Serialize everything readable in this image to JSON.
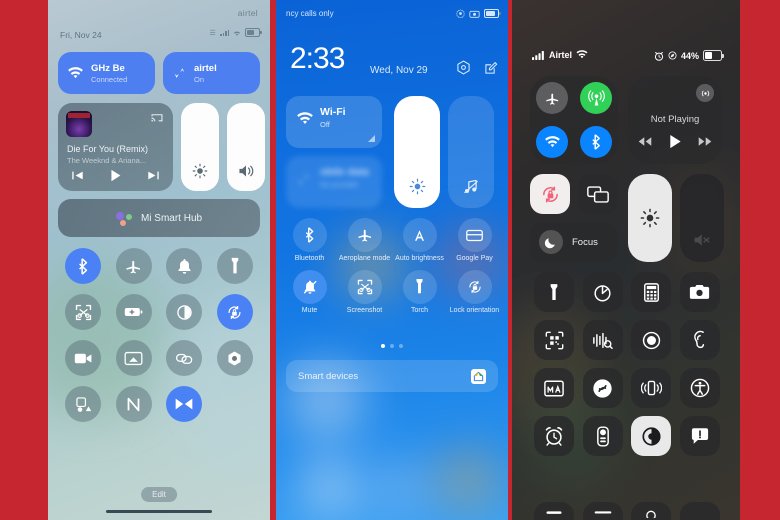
{
  "background_color": "#c62630",
  "panels": {
    "left": {
      "name": "MIUI Control Center (light)",
      "status": {
        "carrier": "airtel",
        "date": "Fri, Nov 24",
        "icons": [
          "vibrate-icon",
          "signal-icon",
          "wifi-icon",
          "battery-icon"
        ]
      },
      "tiles": [
        {
          "name": "wifi-tile",
          "icon": "wifi-icon",
          "title": "GHz   Be",
          "subtitle": "Connected",
          "state": "on"
        },
        {
          "name": "mobile-data-tile",
          "icon": "data-arrows-icon",
          "title": "airtel",
          "subtitle": "On",
          "state": "on"
        }
      ],
      "media": {
        "title": "Die For You (Remix)",
        "artist": "The Weeknd & Ariana...",
        "cast_icon": "cast-icon",
        "controls": [
          "previous-icon",
          "play-icon",
          "next-icon"
        ]
      },
      "sliders": [
        {
          "name": "brightness-slider",
          "icon": "brightness-icon",
          "value": 100
        },
        {
          "name": "volume-slider",
          "icon": "volume-icon",
          "value": 100
        }
      ],
      "smart_hub": {
        "label": "Mi Smart Hub",
        "icon": "assistant-dots-icon"
      },
      "toggles": [
        {
          "name": "bluetooth",
          "icon": "bluetooth-icon",
          "on": true
        },
        {
          "name": "aeroplane-mode",
          "icon": "airplane-icon",
          "on": false
        },
        {
          "name": "ringtone",
          "icon": "bell-icon",
          "on": false
        },
        {
          "name": "torch",
          "icon": "flashlight-icon",
          "on": false
        },
        {
          "name": "screenshot",
          "icon": "screenshot-icon",
          "on": false
        },
        {
          "name": "battery-saver",
          "icon": "battery-plus-icon",
          "on": false
        },
        {
          "name": "dark-mode",
          "icon": "contrast-icon",
          "on": false
        },
        {
          "name": "lock-orientation",
          "icon": "rotation-lock-icon",
          "on": true
        },
        {
          "name": "screen-recorder",
          "icon": "video-camera-icon",
          "on": false
        },
        {
          "name": "cast",
          "icon": "cast-screen-icon",
          "on": false
        },
        {
          "name": "link",
          "icon": "link-icon",
          "on": false
        },
        {
          "name": "settings",
          "icon": "gear-icon",
          "on": false
        },
        {
          "name": "second-space",
          "icon": "second-space-icon",
          "on": false
        },
        {
          "name": "nfc",
          "icon": "nfc-icon",
          "on": false
        },
        {
          "name": "reading-mode",
          "icon": "reading-mode-icon",
          "on": true
        }
      ],
      "edit_label": "Edit"
    },
    "middle": {
      "name": "MIUI Control Center (blue)",
      "status": {
        "carrier_text": "ncy calls only",
        "icons": [
          "settings-icon",
          "camera-icon",
          "battery-icon"
        ]
      },
      "clock": {
        "time": "2:33",
        "date": "Wed, Nov 29"
      },
      "actions": [
        "settings-gear-icon",
        "edit-icon"
      ],
      "tiles": [
        {
          "name": "wifi-tile",
          "icon": "wifi-icon",
          "title": "Wi-Fi",
          "subtitle": "Off",
          "blurred": false
        },
        {
          "name": "mobile-data-tile",
          "icon": "data-arrows-icon",
          "title": "obile data",
          "subtitle": "No provider",
          "blurred": true
        }
      ],
      "sliders": [
        {
          "name": "brightness-slider",
          "icon": "brightness-icon",
          "value": 100
        },
        {
          "name": "volume-slider",
          "icon": "music-note-icon",
          "value": 0
        }
      ],
      "toggles": [
        {
          "name": "bluetooth",
          "label": "Bluetooth",
          "icon": "bluetooth-icon",
          "on": false
        },
        {
          "name": "aeroplane-mode",
          "label": "Aeroplane mode",
          "icon": "airplane-icon",
          "on": false
        },
        {
          "name": "auto-brightness",
          "label": "Auto brightness",
          "icon": "auto-brightness-icon",
          "on": false
        },
        {
          "name": "google-pay",
          "label": "Google Pay",
          "icon": "card-icon",
          "on": false
        },
        {
          "name": "mute",
          "label": "Mute",
          "icon": "bell-mute-icon",
          "on": true
        },
        {
          "name": "screenshot",
          "label": "Screenshot",
          "icon": "screenshot-icon",
          "on": false
        },
        {
          "name": "torch",
          "label": "Torch",
          "icon": "flashlight-icon",
          "on": false
        },
        {
          "name": "lock-orientation",
          "label": "Lock orientation",
          "icon": "rotation-lock-icon",
          "on": false
        }
      ],
      "pages": {
        "count": 3,
        "active": 1
      },
      "smart_devices": {
        "label": "Smart devices",
        "icon": "google-home-icon"
      }
    },
    "right": {
      "name": "iOS Control Center (dark)",
      "status": {
        "signal_icon": "cellular-bars-icon",
        "carrier": "Airtel",
        "wifi_icon": "wifi-icon",
        "alarm_icon": "alarm-icon",
        "location_icon": "location-icon",
        "battery_percent": "44%"
      },
      "connectivity": [
        {
          "name": "airplane-mode",
          "icon": "airplane-icon",
          "on": false
        },
        {
          "name": "cellular-data",
          "icon": "cellular-antenna-icon",
          "on": true,
          "color": "#31d158"
        },
        {
          "name": "wifi",
          "icon": "wifi-icon",
          "on": true,
          "color": "#0a84ff"
        },
        {
          "name": "bluetooth",
          "icon": "bluetooth-icon",
          "on": true,
          "color": "#0a84ff"
        }
      ],
      "media": {
        "status": "Not Playing",
        "airplay_icon": "airplay-icon",
        "controls": [
          "rewind-icon",
          "play-icon",
          "forward-icon"
        ]
      },
      "rotation_lock": {
        "name": "rotation-lock",
        "icon": "rotation-lock-icon",
        "on": true
      },
      "screen_mirroring": {
        "name": "screen-mirroring",
        "icon": "screen-mirroring-icon",
        "on": false
      },
      "focus": {
        "label": "Focus",
        "icon": "moon-icon",
        "on": false
      },
      "sliders": [
        {
          "name": "brightness-slider",
          "icon": "brightness-icon",
          "value": 100
        },
        {
          "name": "volume-slider",
          "icon": "volume-mute-icon",
          "value": 0
        }
      ],
      "controls": [
        {
          "name": "flashlight",
          "icon": "flashlight-icon",
          "on": false
        },
        {
          "name": "timer",
          "icon": "timer-icon",
          "on": false
        },
        {
          "name": "calculator",
          "icon": "calculator-icon",
          "on": false
        },
        {
          "name": "camera",
          "icon": "camera-icon",
          "on": false
        },
        {
          "name": "code-scanner",
          "icon": "qr-scanner-icon",
          "on": false
        },
        {
          "name": "sound-recognition",
          "icon": "sound-recognition-icon",
          "on": false
        },
        {
          "name": "screen-recording",
          "icon": "record-icon",
          "on": false
        },
        {
          "name": "hearing",
          "icon": "ear-icon",
          "on": false
        },
        {
          "name": "text-size",
          "icon": "text-size-icon",
          "on": false
        },
        {
          "name": "shazam",
          "icon": "shazam-icon",
          "on": false
        },
        {
          "name": "haptics",
          "icon": "vibrate-icon",
          "on": false
        },
        {
          "name": "accessibility",
          "icon": "accessibility-icon",
          "on": false
        },
        {
          "name": "alarm",
          "icon": "alarm-clock-icon",
          "on": false
        },
        {
          "name": "apple-tv-remote",
          "icon": "remote-icon",
          "on": false
        },
        {
          "name": "dark-mode",
          "icon": "dark-mode-icon",
          "on": true
        },
        {
          "name": "announce-notifications",
          "icon": "announce-icon",
          "on": false
        }
      ]
    }
  }
}
